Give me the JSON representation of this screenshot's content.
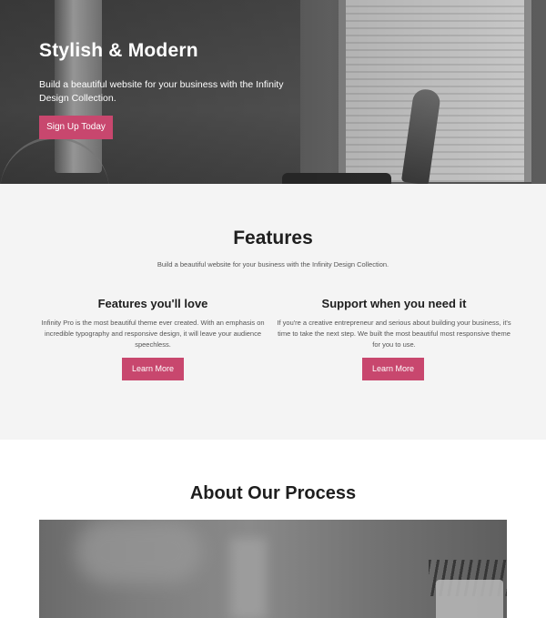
{
  "hero": {
    "title": "Stylish & Modern",
    "subtitle": "Build a beautiful website for your business with the Infinity Design Collection.",
    "button_label": "Sign Up Today"
  },
  "features": {
    "title": "Features",
    "subtitle": "Build a beautiful website for your business with the Infinity Design Collection.",
    "columns": [
      {
        "title": "Features you'll love",
        "text": "Infinity Pro is the most beautiful theme ever created. With an emphasis on incredible typography and responsive design, it will leave your audience speechless.",
        "button_label": "Learn More"
      },
      {
        "title": "Support when you need it",
        "text": "If you're a creative entrepreneur and serious about building your business, it's time to take the next step. We built the most beautiful most responsive theme for you to use.",
        "button_label": "Learn More"
      }
    ]
  },
  "about": {
    "title": "About Our Process"
  },
  "colors": {
    "accent": "#c8476e",
    "features_bg": "#f4f4f4",
    "text_dark": "#1e1e1e"
  }
}
